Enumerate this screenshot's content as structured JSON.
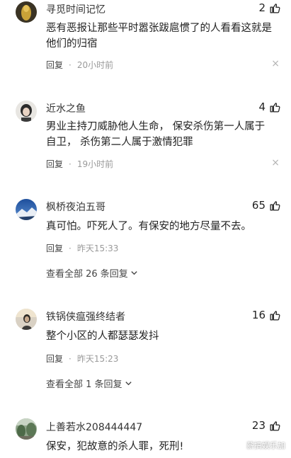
{
  "comments": [
    {
      "username": "寻觅时间记忆",
      "likes": "2",
      "text": "恶有恶报让那些平时嚣张跋扈惯了的人看看这就是他们的归宿",
      "reply_label": "回复",
      "time": "20小时前"
    },
    {
      "username": "近水之鱼",
      "likes": "4",
      "text": "男业主持刀威胁他人生命， 保安杀伤第一人属于自卫， 杀伤第二人属于激情犯罪",
      "reply_label": "回复",
      "time": "19小时前"
    },
    {
      "username": "枫桥夜泊五哥",
      "likes": "65",
      "text": "真可怕。吓死人了。有保安的地方尽量不去。",
      "reply_label": "回复",
      "time": "昨天15:33",
      "view_all": "查看全部 26 条回复"
    },
    {
      "username": "铁锅侠瘟强终结者",
      "likes": "16",
      "text": "整个小区的人都瑟瑟发抖",
      "reply_label": "回复",
      "time": "昨天15:23",
      "view_all": "查看全部 1 条回复"
    },
    {
      "username": "上善若水208444447",
      "likes": "23",
      "text": "保安，犯故意的杀人罪，死刑!"
    }
  ],
  "separator": "·",
  "close_icon": "×",
  "like_icon": "thumbs-up-icon",
  "watermark": "薪搞娱乐加",
  "colors": {
    "text": "#222222",
    "meta": "#9a9a9a",
    "close": "#b3b3b3"
  }
}
